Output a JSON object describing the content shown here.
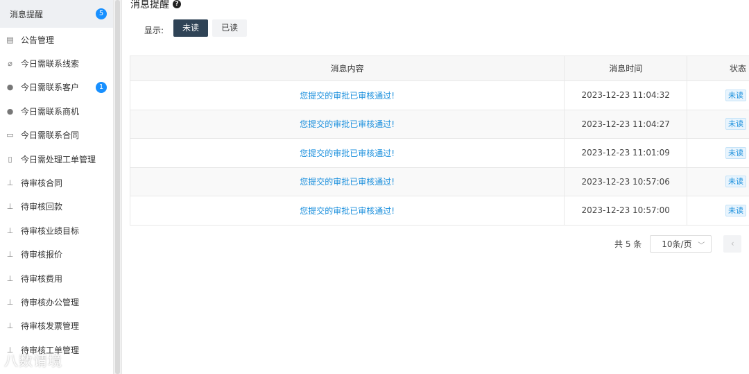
{
  "sidebar": {
    "items": [
      {
        "label": "消息提醒",
        "icon": "none",
        "badge": "5",
        "active": true
      },
      {
        "label": "公告管理",
        "icon": "clipboard-icon",
        "badge": null
      },
      {
        "label": "今日需联系线索",
        "icon": "paperclip-icon",
        "badge": null
      },
      {
        "label": "今日需联系客户",
        "icon": "user-icon",
        "badge": "1"
      },
      {
        "label": "今日需联系商机",
        "icon": "bulb-icon",
        "badge": null
      },
      {
        "label": "今日需联系合同",
        "icon": "folder-icon",
        "badge": null
      },
      {
        "label": "今日需处理工单管理",
        "icon": "document-icon",
        "badge": null
      },
      {
        "label": "待审核合同",
        "icon": "user-audit-icon",
        "badge": null
      },
      {
        "label": "待审核回款",
        "icon": "user-audit-icon",
        "badge": null
      },
      {
        "label": "待审核业绩目标",
        "icon": "user-audit-icon",
        "badge": null
      },
      {
        "label": "待审核报价",
        "icon": "user-audit-icon",
        "badge": null
      },
      {
        "label": "待审核费用",
        "icon": "user-audit-icon",
        "badge": null
      },
      {
        "label": "待审核办公管理",
        "icon": "user-audit-icon",
        "badge": null
      },
      {
        "label": "待审核发票管理",
        "icon": "user-audit-icon",
        "badge": null
      },
      {
        "label": "待审核工单管理",
        "icon": "user-audit-icon",
        "badge": null
      }
    ]
  },
  "watermark": "八数请境",
  "main": {
    "title": "消息提醒",
    "filter": {
      "label": "显示:",
      "unread_label": "未读",
      "read_label": "已读"
    },
    "table": {
      "headers": {
        "content": "消息内容",
        "time": "消息时间",
        "status": "状态"
      },
      "rows": [
        {
          "content": "您提交的审批已审核通过!",
          "time": "2023-12-23 11:04:32",
          "status": "未读"
        },
        {
          "content": "您提交的审批已审核通过!",
          "time": "2023-12-23 11:04:27",
          "status": "未读"
        },
        {
          "content": "您提交的审批已审核通过!",
          "time": "2023-12-23 11:01:09",
          "status": "未读"
        },
        {
          "content": "您提交的审批已审核通过!",
          "time": "2023-12-23 10:57:06",
          "status": "未读"
        },
        {
          "content": "您提交的审批已审核通过!",
          "time": "2023-12-23 10:57:00",
          "status": "未读"
        }
      ]
    },
    "pager": {
      "total": "共 5 条",
      "page_size": "10条/页"
    }
  },
  "colors": {
    "accent": "#1890ff",
    "active_button": "#2f4356",
    "link": "#1a8fdd"
  }
}
